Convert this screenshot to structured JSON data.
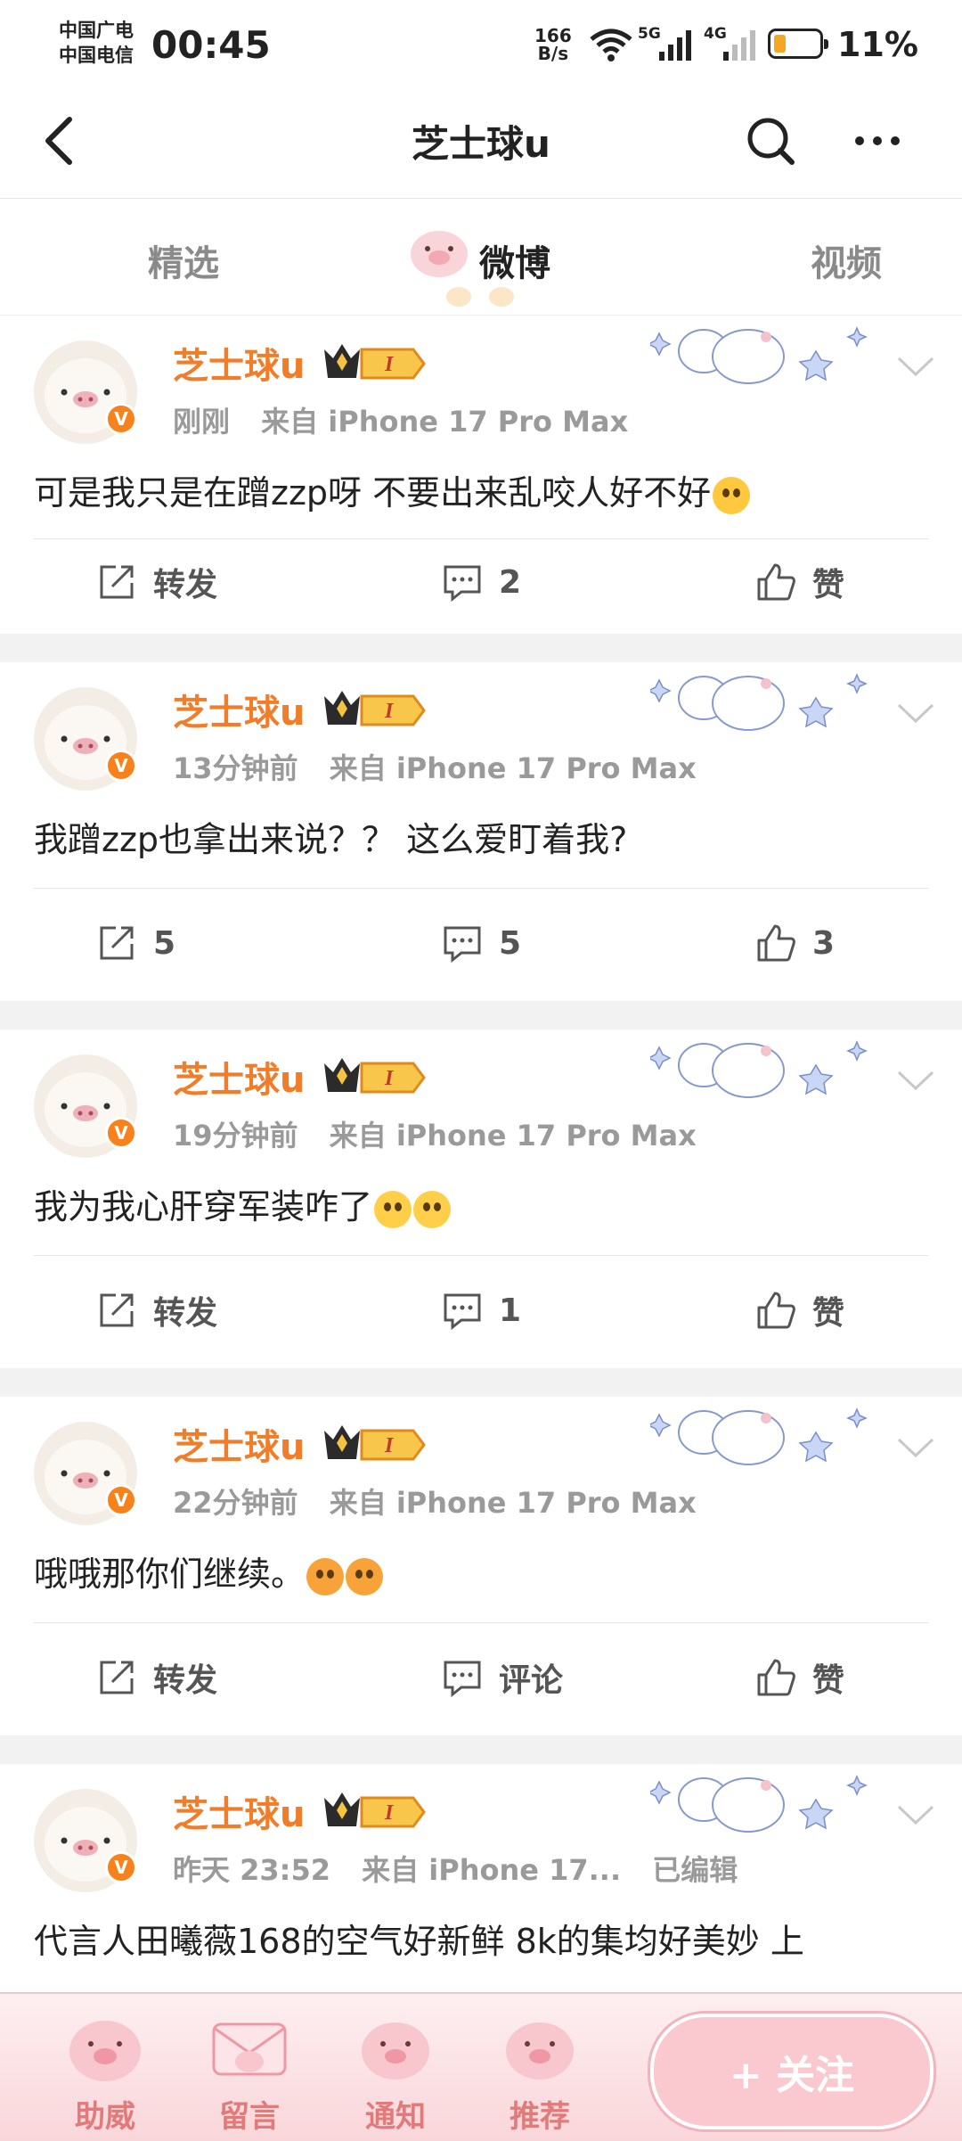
{
  "status_bar": {
    "carrier1": "中国广电",
    "carrier2": "中国电信",
    "time": "00:45",
    "net_speed": "166",
    "net_unit": "B/s",
    "net_5g": "5G",
    "net_4g": "4G",
    "battery": "11%"
  },
  "header": {
    "title": "芝士球u"
  },
  "tabs": [
    {
      "label": "精选"
    },
    {
      "label": "微博"
    },
    {
      "label": "视频"
    }
  ],
  "active_tab": "微博",
  "posts": [
    {
      "author": "芝士球u",
      "time": "刚刚",
      "source": "来自 iPhone 17 Pro Max",
      "text": "可是我只是在蹭zzp呀 不要出来乱咬人好不好",
      "repost": "转发",
      "comment": "2",
      "like": "赞"
    },
    {
      "author": "芝士球u",
      "time": "13分钟前",
      "source": "来自 iPhone 17 Pro Max",
      "text": "我蹭zzp也拿出来说？？ 这么爱盯着我?",
      "repost": "5",
      "comment": "5",
      "like": "3"
    },
    {
      "author": "芝士球u",
      "time": "19分钟前",
      "source": "来自 iPhone 17 Pro Max",
      "text": "我为我心肝穿军装咋了",
      "repost": "转发",
      "comment": "1",
      "like": "赞"
    },
    {
      "author": "芝士球u",
      "time": "22分钟前",
      "source": "来自 iPhone 17 Pro Max",
      "text": "哦哦那你们继续。",
      "repost": "转发",
      "comment": "评论",
      "like": "赞"
    },
    {
      "author": "芝士球u",
      "time": "昨天 23:52",
      "source": "来自 iPhone 17...",
      "edited": "已编辑",
      "text": "代言人田曦薇168的空气好新鲜 8k的集均好美妙 上"
    }
  ],
  "bottom_bar": {
    "items": [
      {
        "label": "助威"
      },
      {
        "label": "留言"
      },
      {
        "label": "通知"
      },
      {
        "label": "推荐"
      }
    ],
    "follow": "+ 关注"
  },
  "colors": {
    "username": "#f07d2a",
    "verified": "#f7821b",
    "bottom_accent": "#e27a7a"
  }
}
